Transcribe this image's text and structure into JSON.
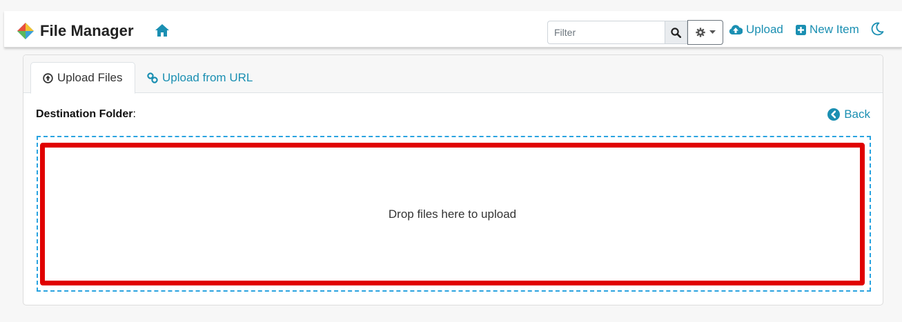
{
  "header": {
    "app_title": "File Manager",
    "filter_placeholder": "Filter",
    "upload_label": "Upload",
    "new_item_label": "New Item"
  },
  "tabs": [
    {
      "label": "Upload Files",
      "icon": "arrow-circle-up-icon",
      "active": true
    },
    {
      "label": "Upload from URL",
      "icon": "link-icon",
      "active": false
    }
  ],
  "destination": {
    "label": "Destination Folder",
    "suffix": ":"
  },
  "back_label": "Back",
  "dropzone": {
    "text": "Drop files here to upload"
  },
  "colors": {
    "accent": "#1a8fb2",
    "dropzone_border": "#29a3e0",
    "highlight": "#e00000"
  }
}
